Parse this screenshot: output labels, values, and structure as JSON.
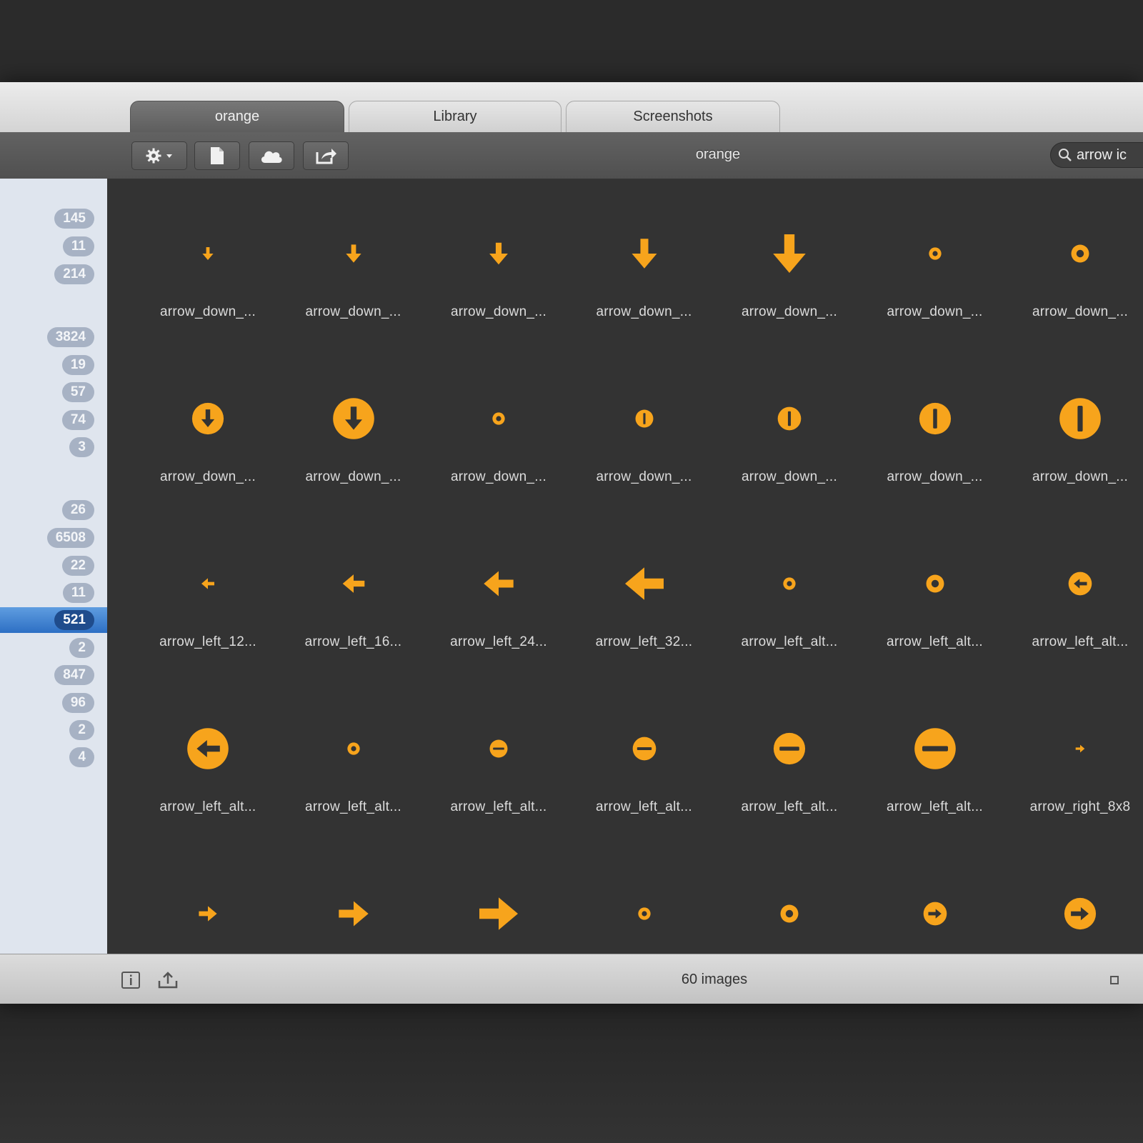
{
  "colors": {
    "accent": "#f7a41c",
    "grid_bg": "#333333",
    "sidebar_bg": "#dfe5ee",
    "selection": "#2d6fc4"
  },
  "tabs": [
    {
      "label": "orange",
      "active": true
    },
    {
      "label": "Library",
      "active": false
    },
    {
      "label": "Screenshots",
      "active": false
    }
  ],
  "toolbar": {
    "title": "orange",
    "buttons": [
      "gear-icon",
      "document-icon",
      "cloud-icon",
      "share-icon"
    ]
  },
  "search": {
    "value": "arrow ic",
    "icon": "search-icon"
  },
  "sidebar": {
    "badges": [
      {
        "count": "145"
      },
      {
        "count": "11"
      },
      {
        "count": "214"
      },
      {
        "count": "3824"
      },
      {
        "count": "19"
      },
      {
        "count": "57"
      },
      {
        "count": "74"
      },
      {
        "count": "3"
      },
      {
        "count": "26"
      },
      {
        "count": "6508"
      },
      {
        "count": "22"
      },
      {
        "count": "11"
      },
      {
        "count": "521",
        "selected": true
      },
      {
        "count": "2"
      },
      {
        "count": "847"
      },
      {
        "count": "96"
      },
      {
        "count": "2"
      },
      {
        "count": "4"
      }
    ]
  },
  "grid": {
    "items": [
      {
        "label": "arrow_down_...",
        "icon": "arrow-down-icon"
      },
      {
        "label": "arrow_down_...",
        "icon": "arrow-down-icon"
      },
      {
        "label": "arrow_down_...",
        "icon": "arrow-down-icon"
      },
      {
        "label": "arrow_down_...",
        "icon": "arrow-down-icon"
      },
      {
        "label": "arrow_down_...",
        "icon": "arrow-down-icon"
      },
      {
        "label": "arrow_down_...",
        "icon": "circle-icon"
      },
      {
        "label": "arrow_down_...",
        "icon": "circle-icon"
      },
      {
        "label": "arrow_down_...",
        "icon": "circle-arrow-down-icon"
      },
      {
        "label": "arrow_down_...",
        "icon": "circle-arrow-down-icon"
      },
      {
        "label": "arrow_down_...",
        "icon": "circle-icon"
      },
      {
        "label": "arrow_down_...",
        "icon": "circle-bar-vertical-icon"
      },
      {
        "label": "arrow_down_...",
        "icon": "circle-bar-vertical-icon"
      },
      {
        "label": "arrow_down_...",
        "icon": "circle-bar-vertical-icon"
      },
      {
        "label": "arrow_down_...",
        "icon": "circle-bar-vertical-icon"
      },
      {
        "label": "arrow_left_12...",
        "icon": "arrow-left-icon"
      },
      {
        "label": "arrow_left_16...",
        "icon": "arrow-left-icon"
      },
      {
        "label": "arrow_left_24...",
        "icon": "arrow-left-icon"
      },
      {
        "label": "arrow_left_32...",
        "icon": "arrow-left-icon"
      },
      {
        "label": "arrow_left_alt...",
        "icon": "circle-icon"
      },
      {
        "label": "arrow_left_alt...",
        "icon": "circle-icon"
      },
      {
        "label": "arrow_left_alt...",
        "icon": "circle-arrow-left-icon"
      },
      {
        "label": "arrow_left_alt...",
        "icon": "circle-arrow-left-icon"
      },
      {
        "label": "arrow_left_alt...",
        "icon": "circle-icon"
      },
      {
        "label": "arrow_left_alt...",
        "icon": "circle-bar-horizontal-icon"
      },
      {
        "label": "arrow_left_alt...",
        "icon": "circle-bar-horizontal-icon"
      },
      {
        "label": "arrow_left_alt...",
        "icon": "circle-bar-horizontal-icon"
      },
      {
        "label": "arrow_left_alt...",
        "icon": "circle-bar-horizontal-icon"
      },
      {
        "label": "arrow_right_8x8",
        "icon": "arrow-right-icon"
      },
      {
        "label": "",
        "icon": "arrow-right-icon"
      },
      {
        "label": "",
        "icon": "arrow-right-icon"
      },
      {
        "label": "",
        "icon": "arrow-right-icon"
      },
      {
        "label": "",
        "icon": "circle-icon"
      },
      {
        "label": "",
        "icon": "circle-icon"
      },
      {
        "label": "",
        "icon": "circle-arrow-right-icon"
      },
      {
        "label": "",
        "icon": "circle-arrow-right-icon"
      }
    ]
  },
  "bottom_bar": {
    "status": "60 images",
    "buttons": [
      "info-icon",
      "upload-icon"
    ],
    "right_icon": "square-icon"
  }
}
